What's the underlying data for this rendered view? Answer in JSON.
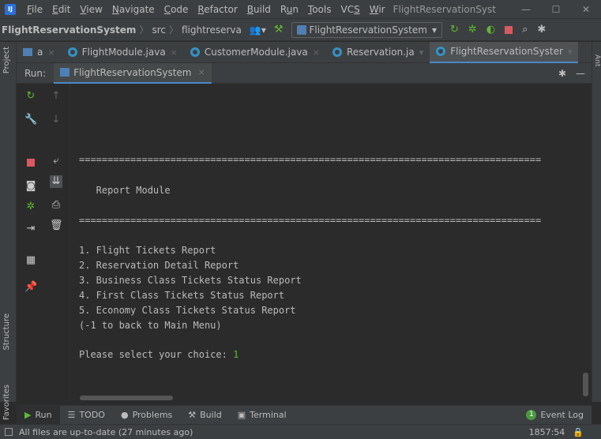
{
  "menubar": {
    "items": [
      "File",
      "Edit",
      "View",
      "Navigate",
      "Code",
      "Refactor",
      "Build",
      "Run",
      "Tools",
      "VCS",
      "Window"
    ],
    "mnemonics": [
      "F",
      "E",
      "V",
      "N",
      "C",
      "R",
      "B",
      "u",
      "T",
      "S",
      "W"
    ],
    "items_display": [
      "ile",
      "dit",
      "iew",
      "avigate",
      "ode",
      "efactor",
      "uild",
      "n",
      "ools",
      "VC",
      "Wir"
    ],
    "window_title": "FlightReservationSyster",
    "minimize": "—",
    "maximize": "☐",
    "close": "✕"
  },
  "navbar": {
    "project": "FlightReservationSystem",
    "crumb1": "src",
    "crumb2": "flightreserva",
    "run_config": "FlightReservationSystem",
    "dropdown": "▾"
  },
  "tabs": [
    {
      "label": "a",
      "close": "×"
    },
    {
      "label": "FlightModule.java",
      "close": "×"
    },
    {
      "label": "CustomerModule.java",
      "close": "×"
    },
    {
      "label": "Reservation.ja",
      "close": "▾"
    },
    {
      "label": "FlightReservationSyster",
      "close": "▾"
    }
  ],
  "left_stripe": {
    "project": "Project",
    "structure": "Structure",
    "favorites": "Favorites"
  },
  "right_stripe": {
    "label": "Ant"
  },
  "run_window": {
    "label": "Run:",
    "tab": "FlightReservationSystem",
    "close": "×",
    "gear": "✱",
    "minimize": "—"
  },
  "console": {
    "separator": "=================================================================================",
    "title": "   Report Module",
    "options": [
      "1. Flight Tickets Report",
      "2. Reservation Detail Report",
      "3. Business Class Tickets Status Report",
      "4. First Class Tickets Status Report",
      "5. Economy Class Tickets Status Report",
      "(-1 to back to Main Menu)"
    ],
    "prompt": "Please select your choice: ",
    "input": "1"
  },
  "bottom_tabs": [
    {
      "label": "Run",
      "icon": "▶"
    },
    {
      "label": "TODO",
      "icon": "☰"
    },
    {
      "label": "Problems",
      "icon": "●"
    },
    {
      "label": "Build",
      "icon": "⚒"
    },
    {
      "label": "Terminal",
      "icon": "▣"
    }
  ],
  "event_log": {
    "count": "1",
    "label": "Event Log"
  },
  "status": {
    "message": "All files are up-to-date (27 minutes ago)",
    "position": "1857:54",
    "lock": "🔒"
  },
  "colors": {
    "background": "#2b2b2b",
    "panel": "#3c3f41",
    "accent": "#4a88c7",
    "run_green": "#5fb832",
    "stop_red": "#db5860"
  }
}
